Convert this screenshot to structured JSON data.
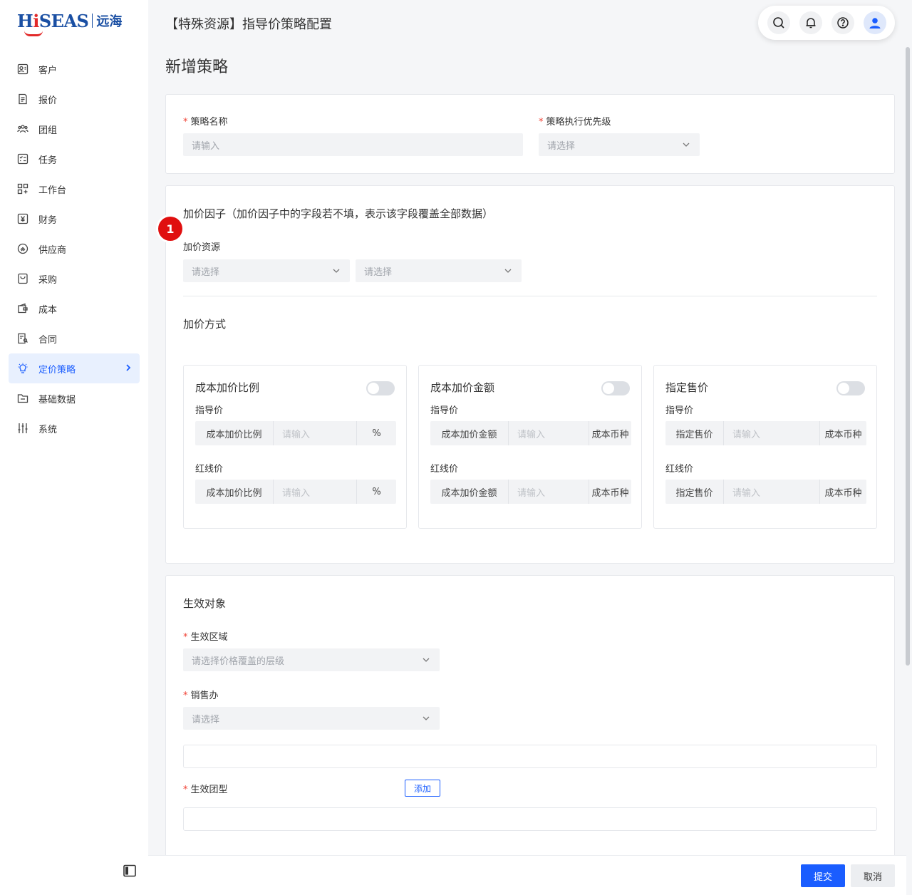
{
  "brand": {
    "logo_latin_1": "H",
    "logo_latin_red": "i",
    "logo_latin_2": "SEAS",
    "logo_cn": "远海"
  },
  "sidebar": {
    "items": [
      {
        "label": "客户",
        "icon": "customer-icon"
      },
      {
        "label": "报价",
        "icon": "quote-icon"
      },
      {
        "label": "团组",
        "icon": "group-icon"
      },
      {
        "label": "任务",
        "icon": "task-icon"
      },
      {
        "label": "工作台",
        "icon": "workbench-icon"
      },
      {
        "label": "财务",
        "icon": "finance-icon"
      },
      {
        "label": "供应商",
        "icon": "supplier-icon"
      },
      {
        "label": "采购",
        "icon": "purchase-icon"
      },
      {
        "label": "成本",
        "icon": "cost-icon"
      },
      {
        "label": "合同",
        "icon": "contract-icon"
      },
      {
        "label": "定价策略",
        "icon": "bulb-icon",
        "active": true
      },
      {
        "label": "基础数据",
        "icon": "folder-icon"
      },
      {
        "label": "系统",
        "icon": "sliders-icon"
      }
    ],
    "active_color": "#1a5dff"
  },
  "header": {
    "title": "【特殊资源】指导价策略配置"
  },
  "page": {
    "subtitle": "新增策略"
  },
  "basic": {
    "name_label": "策略名称",
    "name_placeholder": "请输入",
    "priority_label": "策略执行优先级",
    "priority_placeholder": "请选择"
  },
  "factor": {
    "title": "加价因子（加价因子中的字段若不填，表示该字段覆盖全部数据）",
    "badge": "1",
    "resource_label": "加价资源",
    "select1_placeholder": "请选择",
    "select2_placeholder": "请选择",
    "method_title": "加价方式",
    "methods": [
      {
        "title": "成本加价比例",
        "guide_label": "指导价",
        "red_label": "红线价",
        "prefix": "成本加价比例",
        "placeholder": "请输入",
        "suffix": "%"
      },
      {
        "title": "成本加价金额",
        "guide_label": "指导价",
        "red_label": "红线价",
        "prefix": "成本加价金额",
        "placeholder": "请输入",
        "suffix": "成本币种"
      },
      {
        "title": "指定售价",
        "guide_label": "指导价",
        "red_label": "红线价",
        "prefix": "指定售价",
        "placeholder": "请输入",
        "suffix": "成本币种"
      }
    ]
  },
  "target": {
    "title": "生效对象",
    "region_label": "生效区域",
    "region_placeholder": "请选择价格覆盖的层级",
    "office_label": "销售办",
    "office_placeholder": "请选择",
    "group_type_label": "生效团型",
    "add_label": "添加"
  },
  "footer": {
    "submit": "提交",
    "cancel": "取消"
  }
}
